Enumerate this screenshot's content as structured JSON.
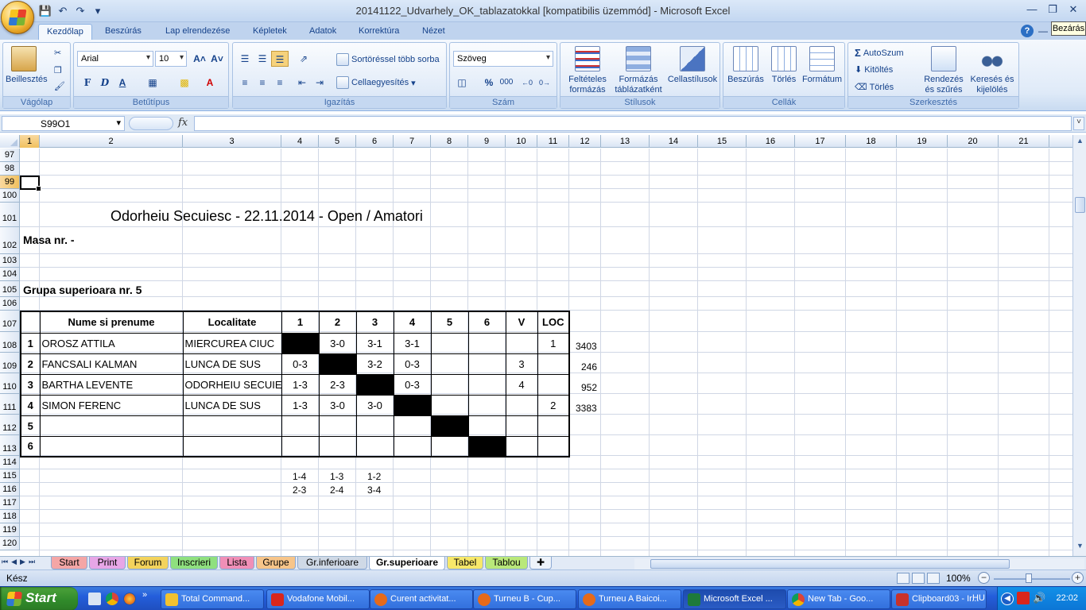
{
  "window": {
    "title": "20141122_Udvarhely_OK_tablazatokkal  [kompatibilis üzemmód] - Microsoft Excel",
    "tooltip_close": "Bezárás"
  },
  "ribbon": {
    "tabs": [
      "Kezdőlap",
      "Beszúrás",
      "Lap elrendezése",
      "Képletek",
      "Adatok",
      "Korrektúra",
      "Nézet"
    ],
    "active_tab": "Kezdőlap",
    "groups": {
      "clipboard": {
        "label": "Vágólap",
        "paste": "Beillesztés"
      },
      "font": {
        "label": "Betűtípus",
        "font_name": "Arial",
        "font_size": "10",
        "bold": "F",
        "italic": "D",
        "underline": "A"
      },
      "alignment": {
        "label": "Igazítás",
        "wrap": "Sortöréssel több sorba",
        "merge": "Cellaegyesítés"
      },
      "number": {
        "label": "Szám",
        "format": "Szöveg",
        "percent": "%",
        "thousands": "000"
      },
      "styles": {
        "label": "Stílusok",
        "conditional": "Feltételes formázás",
        "as_table": "Formázás táblázatként",
        "cell_styles": "Cellastílusok"
      },
      "cells": {
        "label": "Cellák",
        "insert": "Beszúrás",
        "delete": "Törlés",
        "format": "Formátum"
      },
      "editing": {
        "label": "Szerkesztés",
        "autosum": "AutoSzum",
        "fill": "Kitöltés",
        "clear": "Törlés",
        "sort": "Rendezés és szűrés",
        "find": "Keresés és kijelölés"
      }
    }
  },
  "formula_bar": {
    "name_box": "S99O1",
    "fx": "fx",
    "formula": ""
  },
  "columns": [
    "1",
    "2",
    "3",
    "4",
    "5",
    "6",
    "7",
    "8",
    "9",
    "10",
    "11",
    "12",
    "13",
    "14",
    "15",
    "16",
    "17",
    "18",
    "19",
    "20",
    "21"
  ],
  "rows": [
    "97",
    "98",
    "99",
    "100",
    "101",
    "102",
    "103",
    "104",
    "105",
    "106",
    "107",
    "108",
    "109",
    "110",
    "111",
    "112",
    "113",
    "114",
    "115",
    "116",
    "117",
    "118",
    "119",
    "120"
  ],
  "sheet": {
    "title": "Odorheiu Secuiesc - 22.11.2014 - Open / Amatori",
    "masa": "Masa nr.  -",
    "group_title": "Grupa superioara nr. 5",
    "table": {
      "headers": [
        "",
        "Nume si prenume",
        "Localitate",
        "1",
        "2",
        "3",
        "4",
        "5",
        "6",
        "V",
        "LOC"
      ],
      "rows": [
        {
          "n": "1",
          "name": "OROSZ ATTILA",
          "city": "MIERCUREA CIUC",
          "r1": "",
          "r2": "3-0",
          "r3": "3-1",
          "r4": "3-1",
          "r5": "",
          "r6": "",
          "v": "",
          "loc": "1",
          "side": "3403"
        },
        {
          "n": "2",
          "name": "FANCSALI KALMAN",
          "city": "LUNCA DE SUS",
          "r1": "0-3",
          "r2": "",
          "r3": "3-2",
          "r4": "0-3",
          "r5": "",
          "r6": "",
          "v": "3",
          "loc": "",
          "side": "246"
        },
        {
          "n": "3",
          "name": "BARTHA LEVENTE",
          "city": "ODORHEIU SECUIESC",
          "r1": "1-3",
          "r2": "2-3",
          "r3": "",
          "r4": "0-3",
          "r5": "",
          "r6": "",
          "v": "4",
          "loc": "",
          "side": "952"
        },
        {
          "n": "4",
          "name": "SIMON FERENC",
          "city": "LUNCA DE SUS",
          "r1": "1-3",
          "r2": "3-0",
          "r3": "3-0",
          "r4": "",
          "r5": "",
          "r6": "",
          "v": "",
          "loc": "2",
          "side": "3383"
        },
        {
          "n": "5",
          "name": "",
          "city": "",
          "r1": "",
          "r2": "",
          "r3": "",
          "r4": "",
          "r5": "",
          "r6": "",
          "v": "",
          "loc": "",
          "side": ""
        },
        {
          "n": "6",
          "name": "",
          "city": "",
          "r1": "",
          "r2": "",
          "r3": "",
          "r4": "",
          "r5": "",
          "r6": "",
          "v": "",
          "loc": "",
          "side": ""
        }
      ]
    },
    "pairs_row1": [
      "1-4",
      "1-3",
      "1-2"
    ],
    "pairs_row2": [
      "2-3",
      "2-4",
      "3-4"
    ]
  },
  "sheet_tabs": [
    {
      "label": "Start",
      "color": "#f4a6a6"
    },
    {
      "label": "Print",
      "color": "#e7a6e7"
    },
    {
      "label": "Forum",
      "color": "#f3d35c"
    },
    {
      "label": "Inscrieri",
      "color": "#8fe07f"
    },
    {
      "label": "Lista",
      "color": "#f08fb7"
    },
    {
      "label": "Grupe",
      "color": "#f7c58a"
    },
    {
      "label": "Gr.inferioare",
      "color": "#cfd9e6"
    },
    {
      "label": "Gr.superioare",
      "color": "#ffffff"
    },
    {
      "label": "Tabel",
      "color": "#f7e86a"
    },
    {
      "label": "Tablou",
      "color": "#b9e87a"
    }
  ],
  "active_sheet": "Gr.superioare",
  "status": {
    "text": "Kész",
    "zoom": "100%"
  },
  "taskbar": {
    "start": "Start",
    "tasks": [
      {
        "label": "Total Command...",
        "icon_color": "#f2c230"
      },
      {
        "label": "Vodafone Mobil...",
        "icon_color": "#d9261c"
      },
      {
        "label": "Curent activitat...",
        "icon_color": "#e66a1a"
      },
      {
        "label": "Turneu B - Cup...",
        "icon_color": "#e66a1a"
      },
      {
        "label": "Turneu A Baicoi...",
        "icon_color": "#e66a1a"
      },
      {
        "label": "Microsoft Excel ...",
        "icon_color": "#1e7a3a"
      },
      {
        "label": "New Tab - Goo...",
        "icon_color": "#e6b71e"
      },
      {
        "label": "Clipboard03 - Ir...",
        "icon_color": "#c8322b"
      }
    ],
    "lang": "HU",
    "clock": "22:02"
  }
}
